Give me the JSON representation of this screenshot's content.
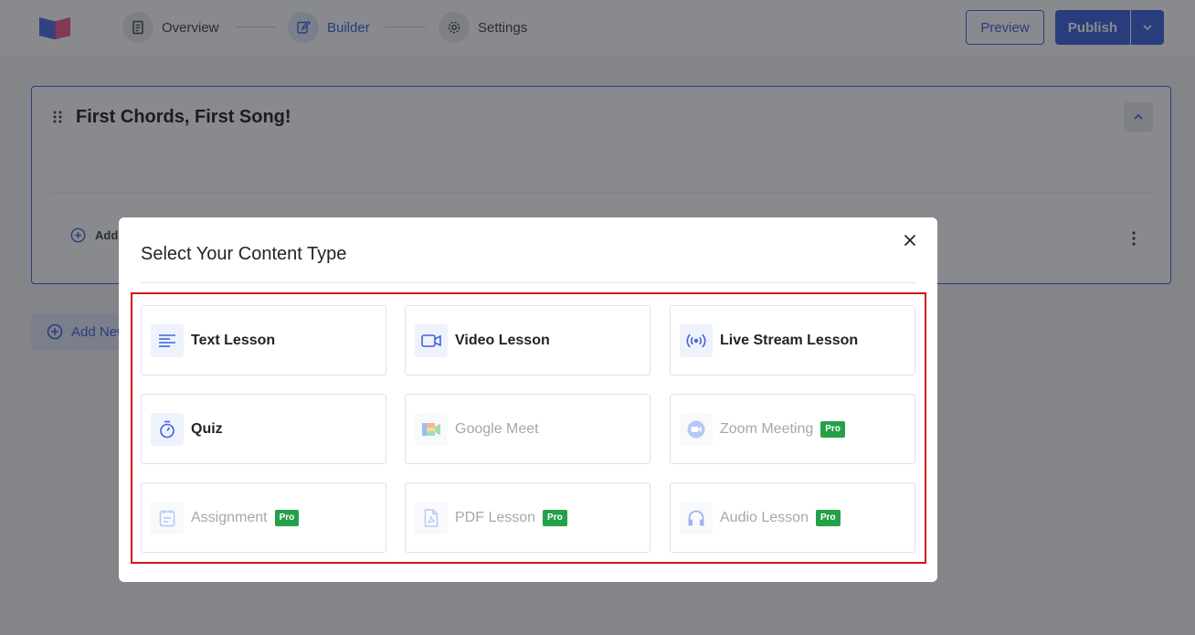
{
  "header": {
    "steps": [
      {
        "label": "Overview",
        "active": false,
        "icon": "document-icon"
      },
      {
        "label": "Builder",
        "active": true,
        "icon": "edit-icon"
      },
      {
        "label": "Settings",
        "active": false,
        "icon": "gear-icon"
      }
    ],
    "preview_label": "Preview",
    "publish_label": "Publish"
  },
  "topic": {
    "title": "First Chords, First Song!",
    "add_content_label": "Add"
  },
  "add_topic_label": "Add New",
  "modal": {
    "title": "Select Your Content Type",
    "options": [
      {
        "label": "Text Lesson",
        "icon": "text-lines-icon",
        "enabled": true,
        "pro": false
      },
      {
        "label": "Video Lesson",
        "icon": "video-camera-icon",
        "enabled": true,
        "pro": false
      },
      {
        "label": "Live Stream Lesson",
        "icon": "broadcast-icon",
        "enabled": true,
        "pro": false
      },
      {
        "label": "Quiz",
        "icon": "stopwatch-icon",
        "enabled": true,
        "pro": false
      },
      {
        "label": "Google Meet",
        "icon": "google-meet-icon",
        "enabled": false,
        "pro": false
      },
      {
        "label": "Zoom Meeting",
        "icon": "zoom-icon",
        "enabled": false,
        "pro": true
      },
      {
        "label": "Assignment",
        "icon": "calendar-icon",
        "enabled": false,
        "pro": true
      },
      {
        "label": "PDF Lesson",
        "icon": "pdf-file-icon",
        "enabled": false,
        "pro": true
      },
      {
        "label": "Audio Lesson",
        "icon": "headphones-icon",
        "enabled": false,
        "pro": true
      }
    ],
    "pro_badge": "Pro"
  },
  "colors": {
    "accent": "#3e64de",
    "pro_badge": "#24a148",
    "highlight_border": "#d3151c"
  }
}
